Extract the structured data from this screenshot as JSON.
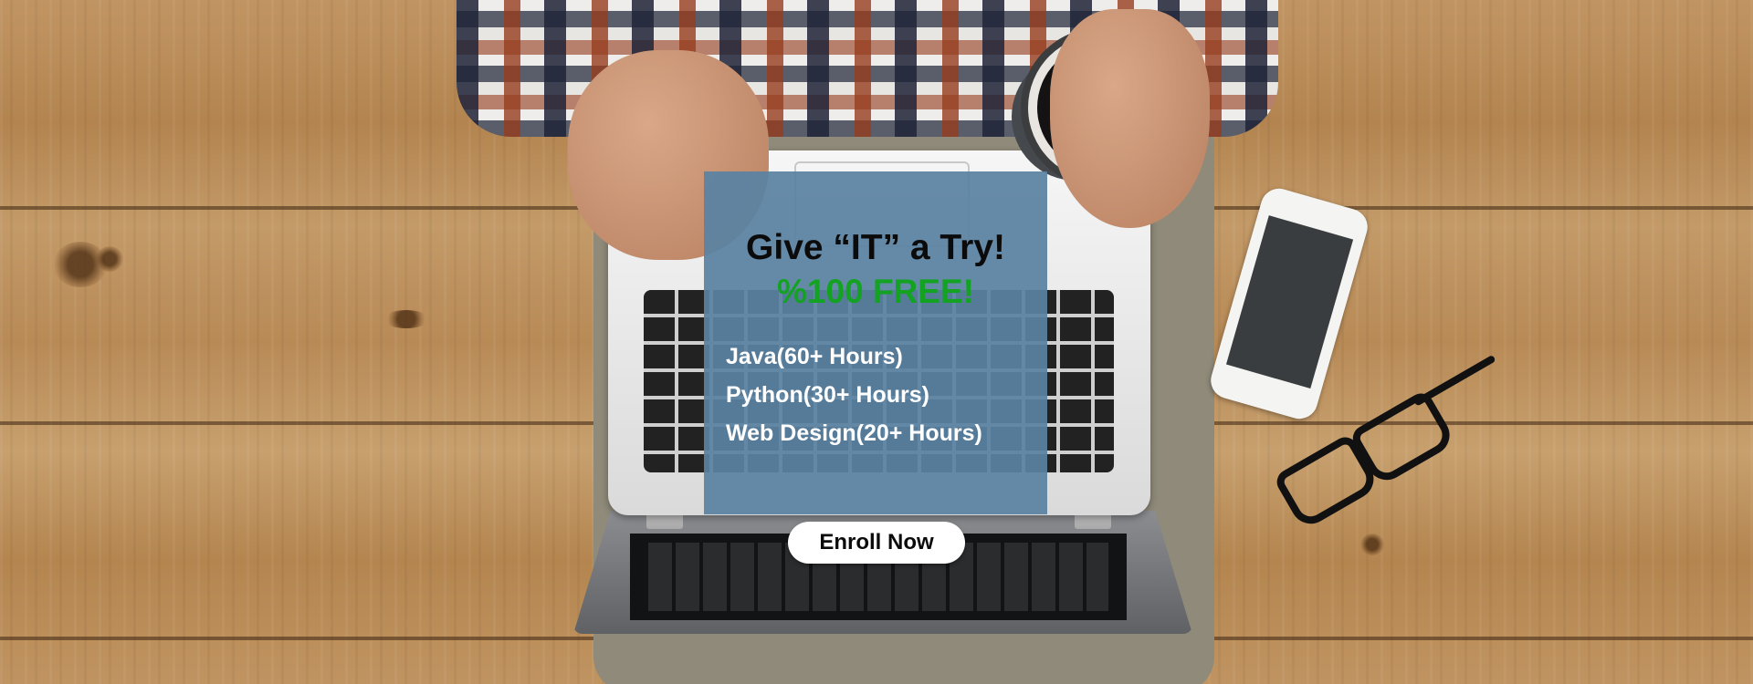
{
  "promo": {
    "title": "Give “IT” a Try!",
    "subtitle": "%100 FREE!",
    "courses": [
      "Java(60+ Hours)",
      "Python(30+ Hours)",
      "Web Design(20+ Hours)"
    ],
    "button_label": "Enroll Now"
  },
  "colors": {
    "panel": "#5a82a2",
    "free_text": "#13a221",
    "button_bg": "#ffffff"
  }
}
